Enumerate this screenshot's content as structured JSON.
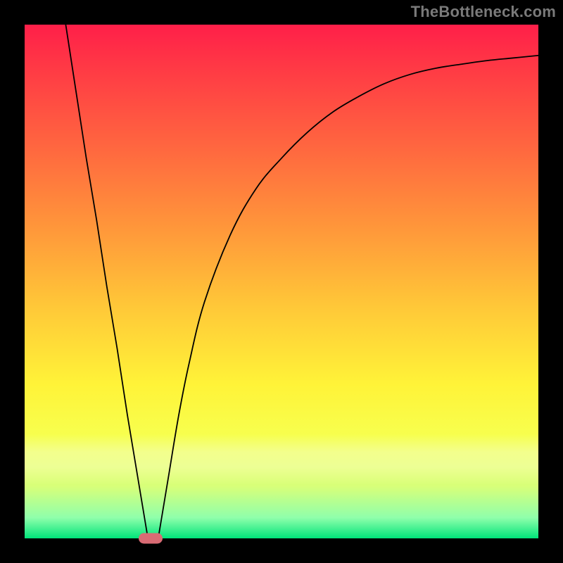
{
  "watermark": "TheBottleneck.com",
  "chart_data": {
    "type": "line",
    "title": "",
    "xlabel": "",
    "ylabel": "",
    "xlim": [
      0,
      100
    ],
    "ylim": [
      0,
      100
    ],
    "series": [
      {
        "name": "curve",
        "x": [
          8,
          10,
          12,
          14,
          16,
          18,
          20,
          22,
          23,
          24,
          25,
          26,
          27,
          28,
          30,
          32,
          35,
          40,
          45,
          50,
          55,
          60,
          65,
          70,
          75,
          80,
          85,
          90,
          95,
          100
        ],
        "y": [
          100,
          87,
          74,
          62,
          49,
          37,
          24,
          12,
          6,
          0,
          0,
          0,
          6,
          12,
          24,
          34,
          46,
          59,
          68,
          74,
          79,
          83,
          86,
          88.5,
          90.3,
          91.5,
          92.3,
          93,
          93.5,
          94
        ]
      }
    ],
    "grid": false,
    "legend": false,
    "background_gradient": {
      "top": "#ff1f49",
      "mid1": "#ff983a",
      "mid2": "#fff338",
      "bottom": "#00e47a"
    },
    "marker": {
      "x": 24.5,
      "y": 0,
      "color": "#d96b74"
    }
  }
}
